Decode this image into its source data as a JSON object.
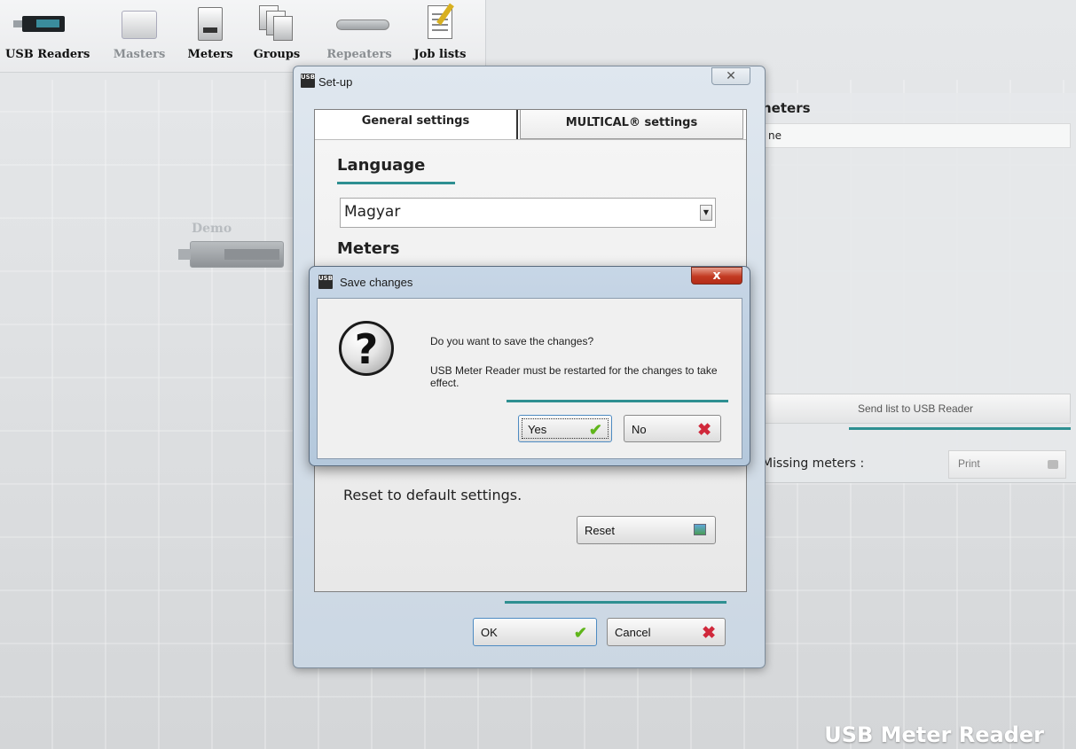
{
  "toolbar": {
    "items": [
      {
        "label": "USB Readers",
        "icon": "usb-reader-icon"
      },
      {
        "label": "Masters",
        "icon": "master-icon"
      },
      {
        "label": "Meters",
        "icon": "meter-icon"
      },
      {
        "label": "Groups",
        "icon": "groups-icon"
      },
      {
        "label": "Repeaters",
        "icon": "repeater-icon"
      },
      {
        "label": "Job lists",
        "icon": "job-list-icon"
      }
    ]
  },
  "background": {
    "device_label": "Demo",
    "panel_title": "neters",
    "panel_field_text": "ne",
    "send_button": "Send list to USB Reader",
    "missing_label": "Missing meters :",
    "print_button": "Print",
    "brand": "USB Meter Reader"
  },
  "setup_dialog": {
    "title": "Set-up",
    "icon_text": "USB",
    "close_symbol": "✕",
    "tabs": [
      {
        "label": "General settings",
        "active": true
      },
      {
        "label": "MULTICAL® settings",
        "active": false
      }
    ],
    "language_heading": "Language",
    "language_value": "Magyar",
    "meters_heading": "Meters",
    "reset_text": "Reset to default settings.",
    "reset_button": "Reset",
    "ok_button": "OK",
    "cancel_button": "Cancel"
  },
  "save_dialog": {
    "title": "Save changes",
    "icon_text": "USB",
    "close_symbol": "x",
    "question_symbol": "?",
    "message1": "Do you want to save the changes?",
    "message2": "USB Meter Reader must be restarted for the changes to take effect.",
    "yes_button": "Yes",
    "no_button": "No"
  },
  "colors": {
    "accent_line": "#2e8f91",
    "check": "#5fb51a",
    "cross": "#d0283b"
  }
}
